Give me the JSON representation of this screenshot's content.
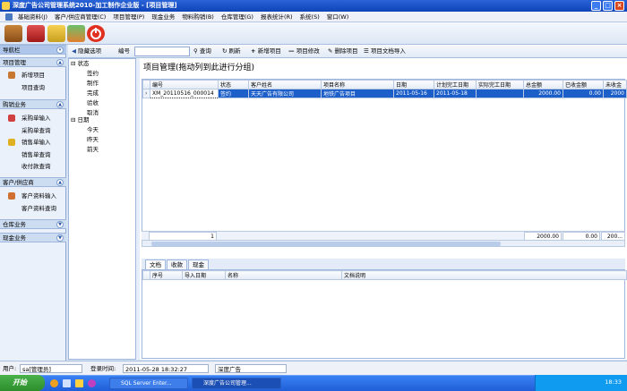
{
  "window": {
    "title": "深度广告公司管理系统2010-加工制作企业版 - [项目管理]"
  },
  "menubar": {
    "items": [
      "基础资料(J)",
      "客户/供应商管理(C)",
      "项目管理(P)",
      "现金业务",
      "物料购销(B)",
      "仓库管理(G)",
      "报表统计(R)",
      "系统(S)",
      "窗口(W)"
    ]
  },
  "nav": {
    "header": "导航栏",
    "sections": [
      {
        "label": "项目管理",
        "items": [
          "新增项目",
          "项目查询"
        ]
      },
      {
        "label": "购销业务",
        "items": [
          "采购单输入",
          "采购单查询",
          "销售单输入",
          "销售单查询",
          "收付款查询"
        ]
      },
      {
        "label": "客户/供应商",
        "items": [
          "客户资料输入",
          "客户资料查询"
        ]
      },
      {
        "label": "仓库业务",
        "items": []
      },
      {
        "label": "现金业务",
        "items": []
      }
    ]
  },
  "toolbar2": {
    "hide_options": "隐藏选项",
    "code_label": "编号",
    "code_value": "",
    "query": "查询",
    "refresh": "刷新",
    "add": "新增项目",
    "edit": "项目修改",
    "delete": "删除项目",
    "doc_import": "项目文档导入"
  },
  "tree": {
    "status_root": "状态",
    "status_children": [
      "签约",
      "制作",
      "完成",
      "验收",
      "取消"
    ],
    "date_root": "日期",
    "date_children": [
      "今天",
      "昨天",
      "前天"
    ]
  },
  "main": {
    "title": "项目管理(拖动列到此进行分组)",
    "columns": [
      "编号",
      "状态",
      "客户姓名",
      "项目名称",
      "日期",
      "计划完工日期",
      "实际完工日期",
      "总金额",
      "已收金额",
      "未收金"
    ],
    "rows": [
      [
        "XM_20110516_000014",
        "签约",
        "天天广告有限公司",
        "地铁广告项目",
        "2011-05-16",
        "2011-05-18",
        "",
        "2000.00",
        "0.00",
        "2000"
      ]
    ],
    "footer": {
      "count": "1",
      "total": "2000.00",
      "received": "0.00",
      "unreceived": "200..."
    }
  },
  "subtabs": {
    "items": [
      "文档",
      "收款",
      "现金"
    ],
    "active": 0
  },
  "subgrid": {
    "columns": [
      "序号",
      "导入日期",
      "名称",
      "文档说明"
    ]
  },
  "statusbar": {
    "user_label": "用户:",
    "user_value": "sa[管理员]",
    "login_label": "登录时间:",
    "login_value": "2011-05-28 18:32:27",
    "company": "深度广告"
  },
  "taskbar": {
    "start": "开始",
    "tasks": [
      "SQL Server Enter...",
      "深度广告公司管理..."
    ],
    "clock": "18:33"
  }
}
